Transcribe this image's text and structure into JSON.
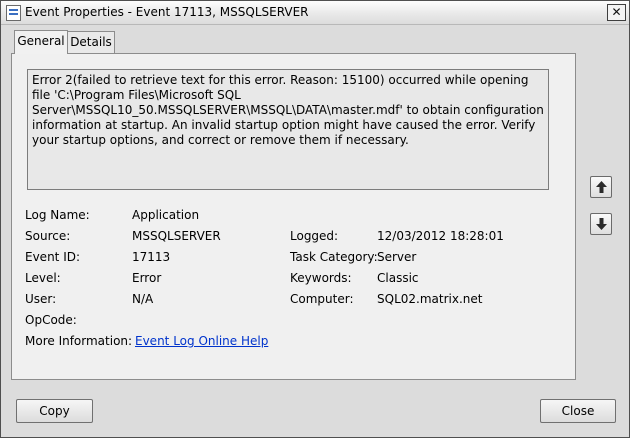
{
  "window": {
    "title": "Event Properties - Event 17113, MSSQLSERVER",
    "close_glyph": "✕"
  },
  "tabs": [
    {
      "label": "General",
      "active": true
    },
    {
      "label": "Details",
      "active": false
    }
  ],
  "description": "Error 2(failed to retrieve text for this error. Reason: 15100) occurred while opening file 'C:\\Program Files\\Microsoft SQL Server\\MSSQL10_50.MSSQLSERVER\\MSSQL\\DATA\\master.mdf' to obtain configuration information at startup. An invalid startup option might have caused the error. Verify your startup options, and correct or remove them if necessary.",
  "fields": {
    "log_name": {
      "label": "Log Name:",
      "value": "Application"
    },
    "source": {
      "label": "Source:",
      "value": "MSSQLSERVER"
    },
    "logged": {
      "label": "Logged:",
      "value": "12/03/2012 18:28:01"
    },
    "event_id": {
      "label": "Event ID:",
      "value": "17113"
    },
    "task_category": {
      "label": "Task Category:",
      "value": "Server"
    },
    "level": {
      "label": "Level:",
      "value": "Error"
    },
    "keywords": {
      "label": "Keywords:",
      "value": "Classic"
    },
    "user": {
      "label": "User:",
      "value": "N/A"
    },
    "computer": {
      "label": "Computer:",
      "value": "SQL02.matrix.net"
    },
    "opcode": {
      "label": "OpCode:",
      "value": ""
    },
    "more_info": {
      "label": "More Information:",
      "link": "Event Log Online Help"
    }
  },
  "icons": {
    "up": "arrow-up-icon",
    "down": "arrow-down-icon",
    "app": "event-viewer-icon"
  },
  "buttons": {
    "copy": "Copy",
    "close": "Close"
  }
}
